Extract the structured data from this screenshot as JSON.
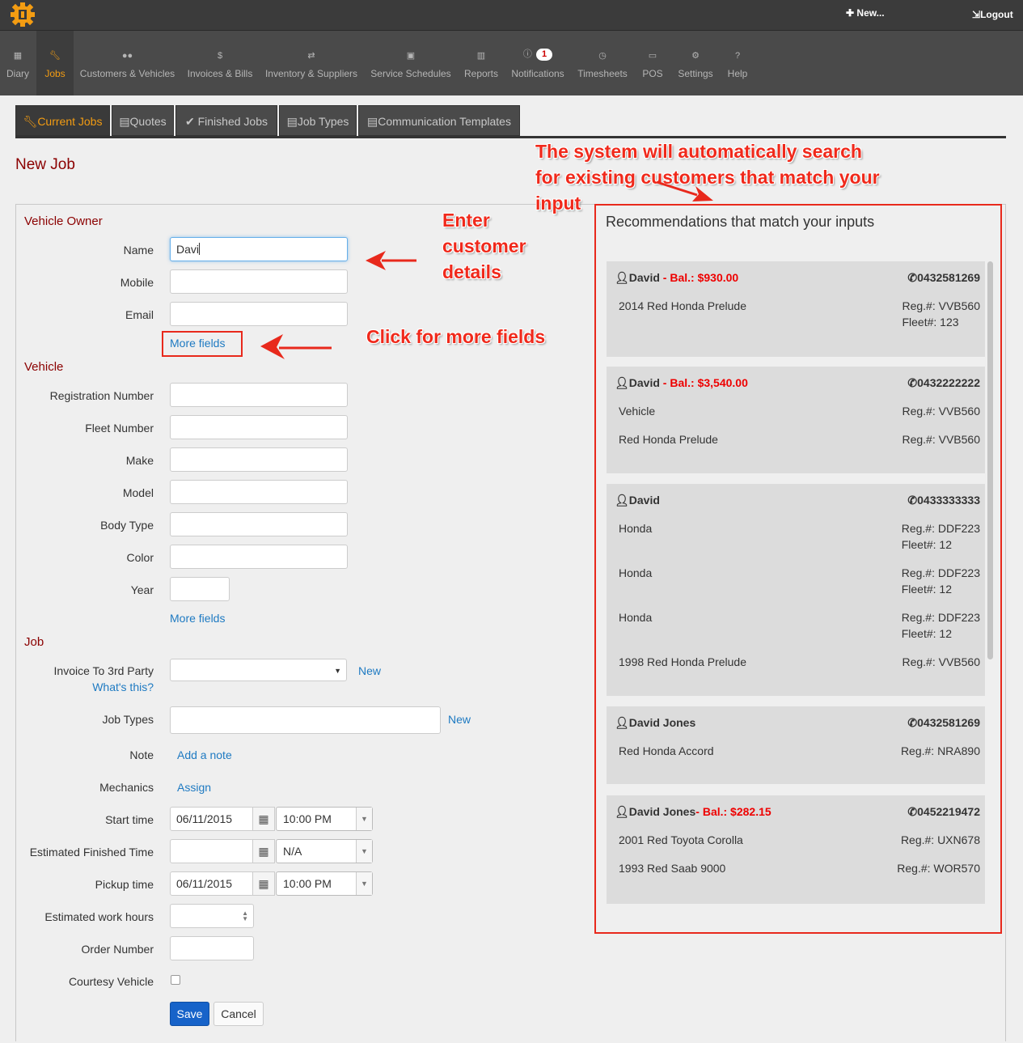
{
  "header": {
    "new_label": "New...",
    "logout_label": "Logout"
  },
  "nav": {
    "items": [
      {
        "label": "Diary",
        "icon": "calendar-icon"
      },
      {
        "label": "Jobs",
        "icon": "wrench-icon"
      },
      {
        "label": "Customers & Vehicles",
        "icon": "users-icon"
      },
      {
        "label": "Invoices & Bills",
        "icon": "dollar-icon"
      },
      {
        "label": "Inventory & Suppliers",
        "icon": "retweet-icon"
      },
      {
        "label": "Service Schedules",
        "icon": "calendar-icon"
      },
      {
        "label": "Reports",
        "icon": "chart-icon"
      },
      {
        "label": "Notifications",
        "icon": "info-icon"
      },
      {
        "label": "Timesheets",
        "icon": "clock-icon"
      },
      {
        "label": "POS",
        "icon": "money-icon"
      },
      {
        "label": "Settings",
        "icon": "gears-icon"
      },
      {
        "label": "Help",
        "icon": "question-icon"
      }
    ],
    "notification_count": "1"
  },
  "tabs": [
    {
      "label": "Current Jobs"
    },
    {
      "label": "Quotes"
    },
    {
      "label": "Finished Jobs"
    },
    {
      "label": "Job Types"
    },
    {
      "label": "Communication Templates"
    }
  ],
  "page_title": "New Job",
  "form": {
    "owner_section": "Vehicle Owner",
    "name_label": "Name",
    "name_value": "Davi",
    "mobile_label": "Mobile",
    "email_label": "Email",
    "more_fields": "More fields",
    "vehicle_section": "Vehicle",
    "reg_label": "Registration Number",
    "fleet_label": "Fleet Number",
    "make_label": "Make",
    "model_label": "Model",
    "body_label": "Body Type",
    "color_label": "Color",
    "year_label": "Year",
    "more_fields_2": "More fields",
    "job_section": "Job",
    "invoice_label": "Invoice To 3rd Party",
    "whats_this": "What's this?",
    "invoice_new": "New",
    "jobtypes_label": "Job Types",
    "jobtypes_new": "New",
    "note_label": "Note",
    "add_note": "Add a note",
    "mechanics_label": "Mechanics",
    "assign": "Assign",
    "start_label": "Start time",
    "start_date": "06/11/2015",
    "start_time": "10:00 PM",
    "est_finish_label": "Estimated Finished Time",
    "est_finish_time": "N/A",
    "pickup_label": "Pickup time",
    "pickup_date": "06/11/2015",
    "pickup_time": "10:00 PM",
    "work_hours_label": "Estimated work hours",
    "order_label": "Order Number",
    "courtesy_label": "Courtesy Vehicle",
    "save": "Save",
    "cancel": "Cancel"
  },
  "recommendations": {
    "title": "Recommendations that match your inputs",
    "cards": [
      {
        "name": "David",
        "sep": " - ",
        "balance": "Bal.: $930.00",
        "phone": "0432581269",
        "vehicles": [
          {
            "desc": "2014 Red Honda Prelude",
            "reg": "Reg.#: VVB560",
            "fleet": "Fleet#: 123"
          }
        ]
      },
      {
        "name": "David",
        "sep": " - ",
        "balance": "Bal.: $3,540.00",
        "phone": "0432222222",
        "vehicles": [
          {
            "desc": "Vehicle",
            "reg": "Reg.#: VVB560"
          },
          {
            "desc": "Red Honda Prelude",
            "reg": "Reg.#: VVB560"
          }
        ]
      },
      {
        "name": "David",
        "phone": "0433333333",
        "vehicles": [
          {
            "desc": "Honda",
            "reg": "Reg.#: DDF223",
            "fleet": "Fleet#: 12"
          },
          {
            "desc": "Honda",
            "reg": "Reg.#: DDF223",
            "fleet": "Fleet#: 12"
          },
          {
            "desc": "Honda",
            "reg": "Reg.#: DDF223",
            "fleet": "Fleet#: 12"
          },
          {
            "desc": "1998 Red Honda Prelude",
            "reg": "Reg.#: VVB560"
          }
        ]
      },
      {
        "name": "David Jones",
        "phone": "0432581269",
        "vehicles": [
          {
            "desc": "Red Honda Accord",
            "reg": "Reg.#: NRA890"
          }
        ]
      },
      {
        "name": "David Jones",
        "sep": "- ",
        "balance": "Bal.: $282.15",
        "phone": "0452219472",
        "vehicles": [
          {
            "desc": "2001 Red Toyota Corolla",
            "reg": "Reg.#: UXN678"
          },
          {
            "desc": "1993 Red Saab 9000",
            "reg": "Reg.#: WOR570"
          }
        ]
      }
    ]
  },
  "annotations": {
    "system_line1": "The system will automatically search",
    "system_line2": "for existing customers that match your",
    "system_line3": "input",
    "enter_line1": "Enter",
    "enter_line2": "customer",
    "enter_line3": "details",
    "click_more": "Click for more fields"
  },
  "colors": {
    "accent": "#f39c12",
    "annotation_red": "#f0291b",
    "section_title": "#8b0000",
    "link": "#1e7ac2",
    "save_button": "#1763c9"
  }
}
